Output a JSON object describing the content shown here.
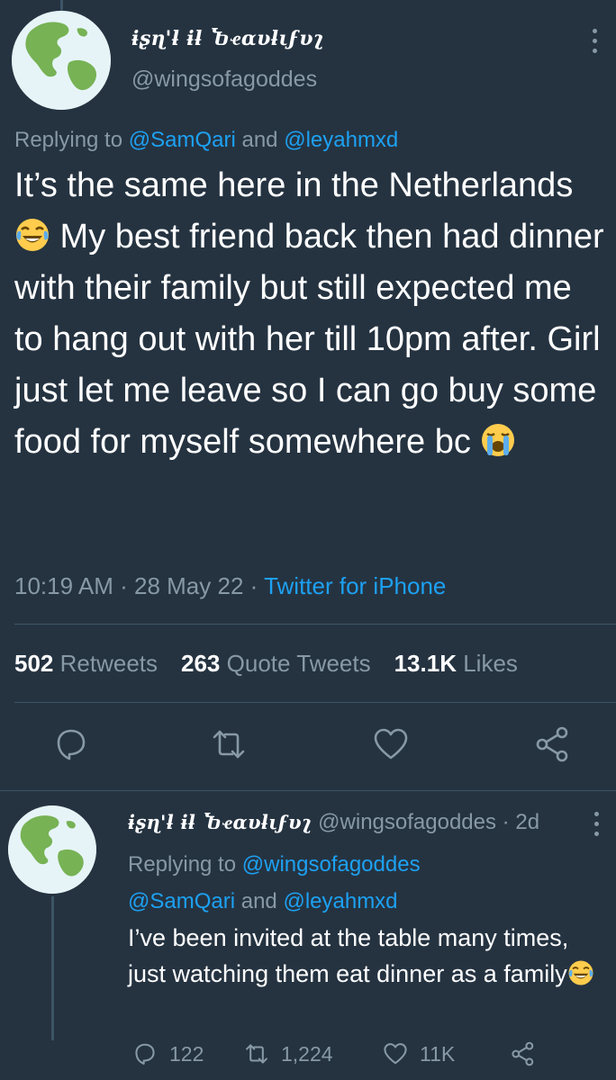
{
  "main_tweet": {
    "display_name": "ɨʂɳ'ƚ ɨƚ Ⴆҽαυƚιϝυʅ",
    "display_name_plain": "isn't it beautiful",
    "handle": "@wingsofagoddes",
    "replying_prefix": "Replying to",
    "replying_user1": "@SamQari",
    "replying_and": "and",
    "replying_user2": "@leyahmxd",
    "text_part1": "It’s the same here in the Netherlands",
    "text_part2": " My best friend back then had dinner with their family but still expected me to hang out with her till 10pm after. Girl just let me leave so I can go buy some food for myself somewhere bc ",
    "time": "10:19 AM",
    "date": "28 May 22",
    "source": "Twitter for iPhone",
    "retweets_count": "502",
    "retweets_label": "Retweets",
    "quotes_count": "263",
    "quotes_label": "Quote Tweets",
    "likes_count": "13.1K",
    "likes_label": "Likes"
  },
  "reply_tweet": {
    "display_name": "ɨʂɳ'ƚ ɨƚ Ⴆҽαυƚιϝυʅ",
    "handle": "@wingsofagoddes",
    "age": "2d",
    "replying_prefix": "Replying to",
    "replying_user1": "@wingsofagoddes",
    "replying_user2": "@SamQari",
    "replying_and": "and",
    "replying_user3": "@leyahmxd",
    "text": "I’ve been invited at the table many times, just watching them eat dinner as a family",
    "replies": "122",
    "retweets": "1,224",
    "likes": "11K"
  },
  "icons": {
    "avatar": "earth-globe-icon",
    "emoji1": "face-with-tears-of-joy",
    "emoji2": "loudly-crying-face",
    "more": "more-vertical-icon",
    "reply": "reply-icon",
    "retweet": "retweet-icon",
    "like": "heart-icon",
    "share": "share-icon"
  },
  "colors": {
    "background": "#253341",
    "secondary_text": "#8899a6",
    "link": "#1da1f2",
    "divider": "#3d5466"
  }
}
